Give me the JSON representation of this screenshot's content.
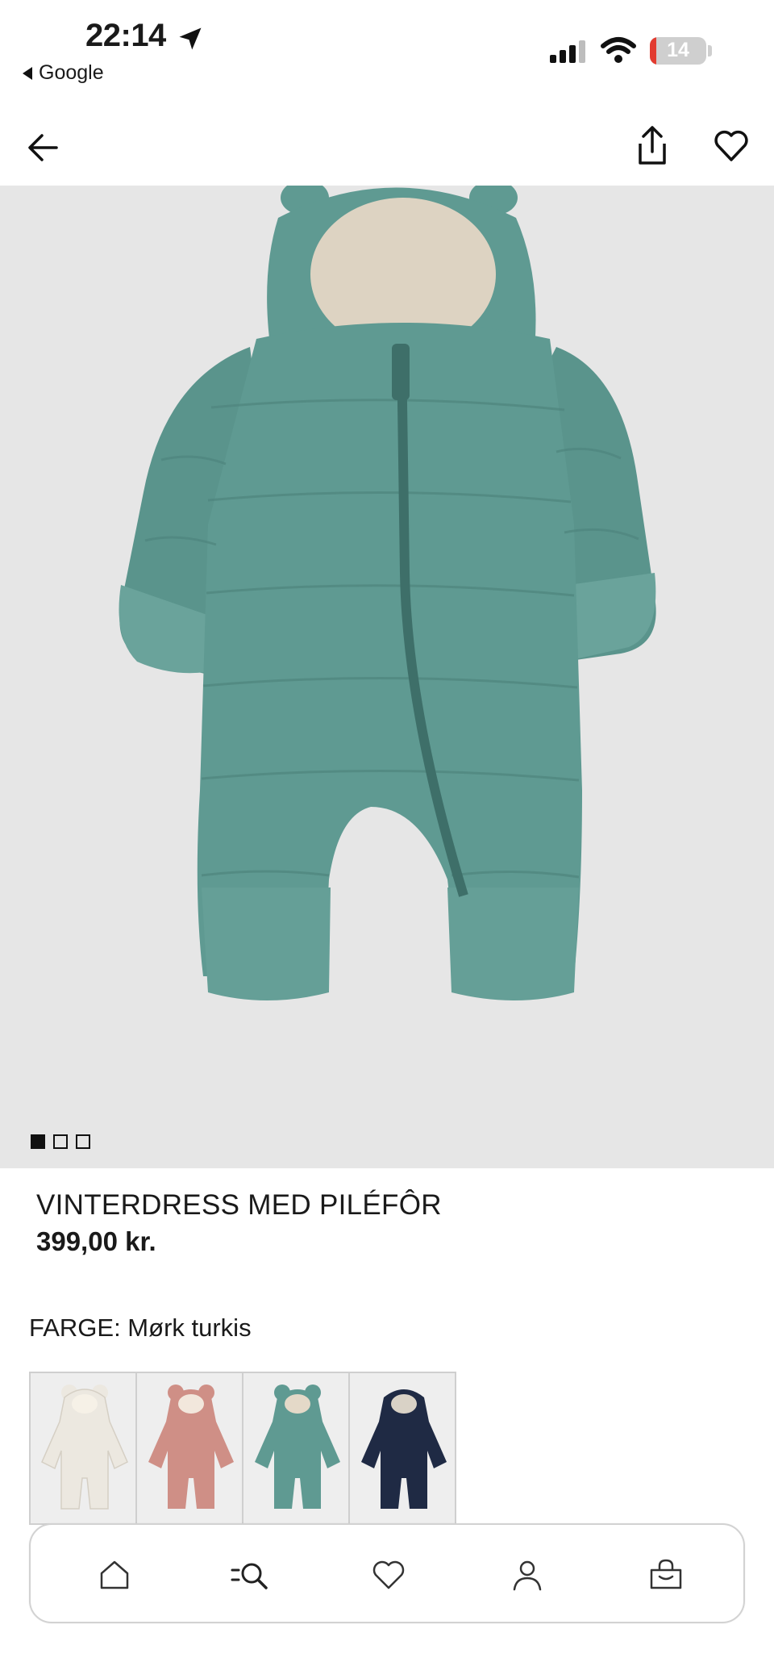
{
  "status_bar": {
    "time": "22:14",
    "back_app": "Google",
    "battery_level": "14"
  },
  "top_nav": {
    "back_icon": "arrow-left-icon",
    "share_icon": "share-icon",
    "favorite_icon": "heart-icon"
  },
  "gallery": {
    "image_count": 3,
    "active_index": 0
  },
  "product": {
    "title": "VINTERDRESS MED PILÉFÔR",
    "price": "399,00 kr."
  },
  "color": {
    "label": "FARGE: Mørk turkis",
    "options": [
      {
        "name": "light-beige",
        "hex": "#ece8e0"
      },
      {
        "name": "dusty-pink",
        "hex": "#cf8f86"
      },
      {
        "name": "dark-turquoise",
        "hex": "#5f9a92"
      },
      {
        "name": "navy",
        "hex": "#1f2a44"
      }
    ],
    "selected_index": 2
  },
  "colors": {
    "product_teal": "#5f9a92",
    "image_bg": "#e6e6e6",
    "text": "#1a1a1a",
    "battery_low": "#e23b30"
  },
  "tab_bar": {
    "items": [
      {
        "icon": "home-icon"
      },
      {
        "icon": "search-icon"
      },
      {
        "icon": "heart-icon"
      },
      {
        "icon": "account-icon"
      },
      {
        "icon": "bag-icon"
      }
    ]
  }
}
